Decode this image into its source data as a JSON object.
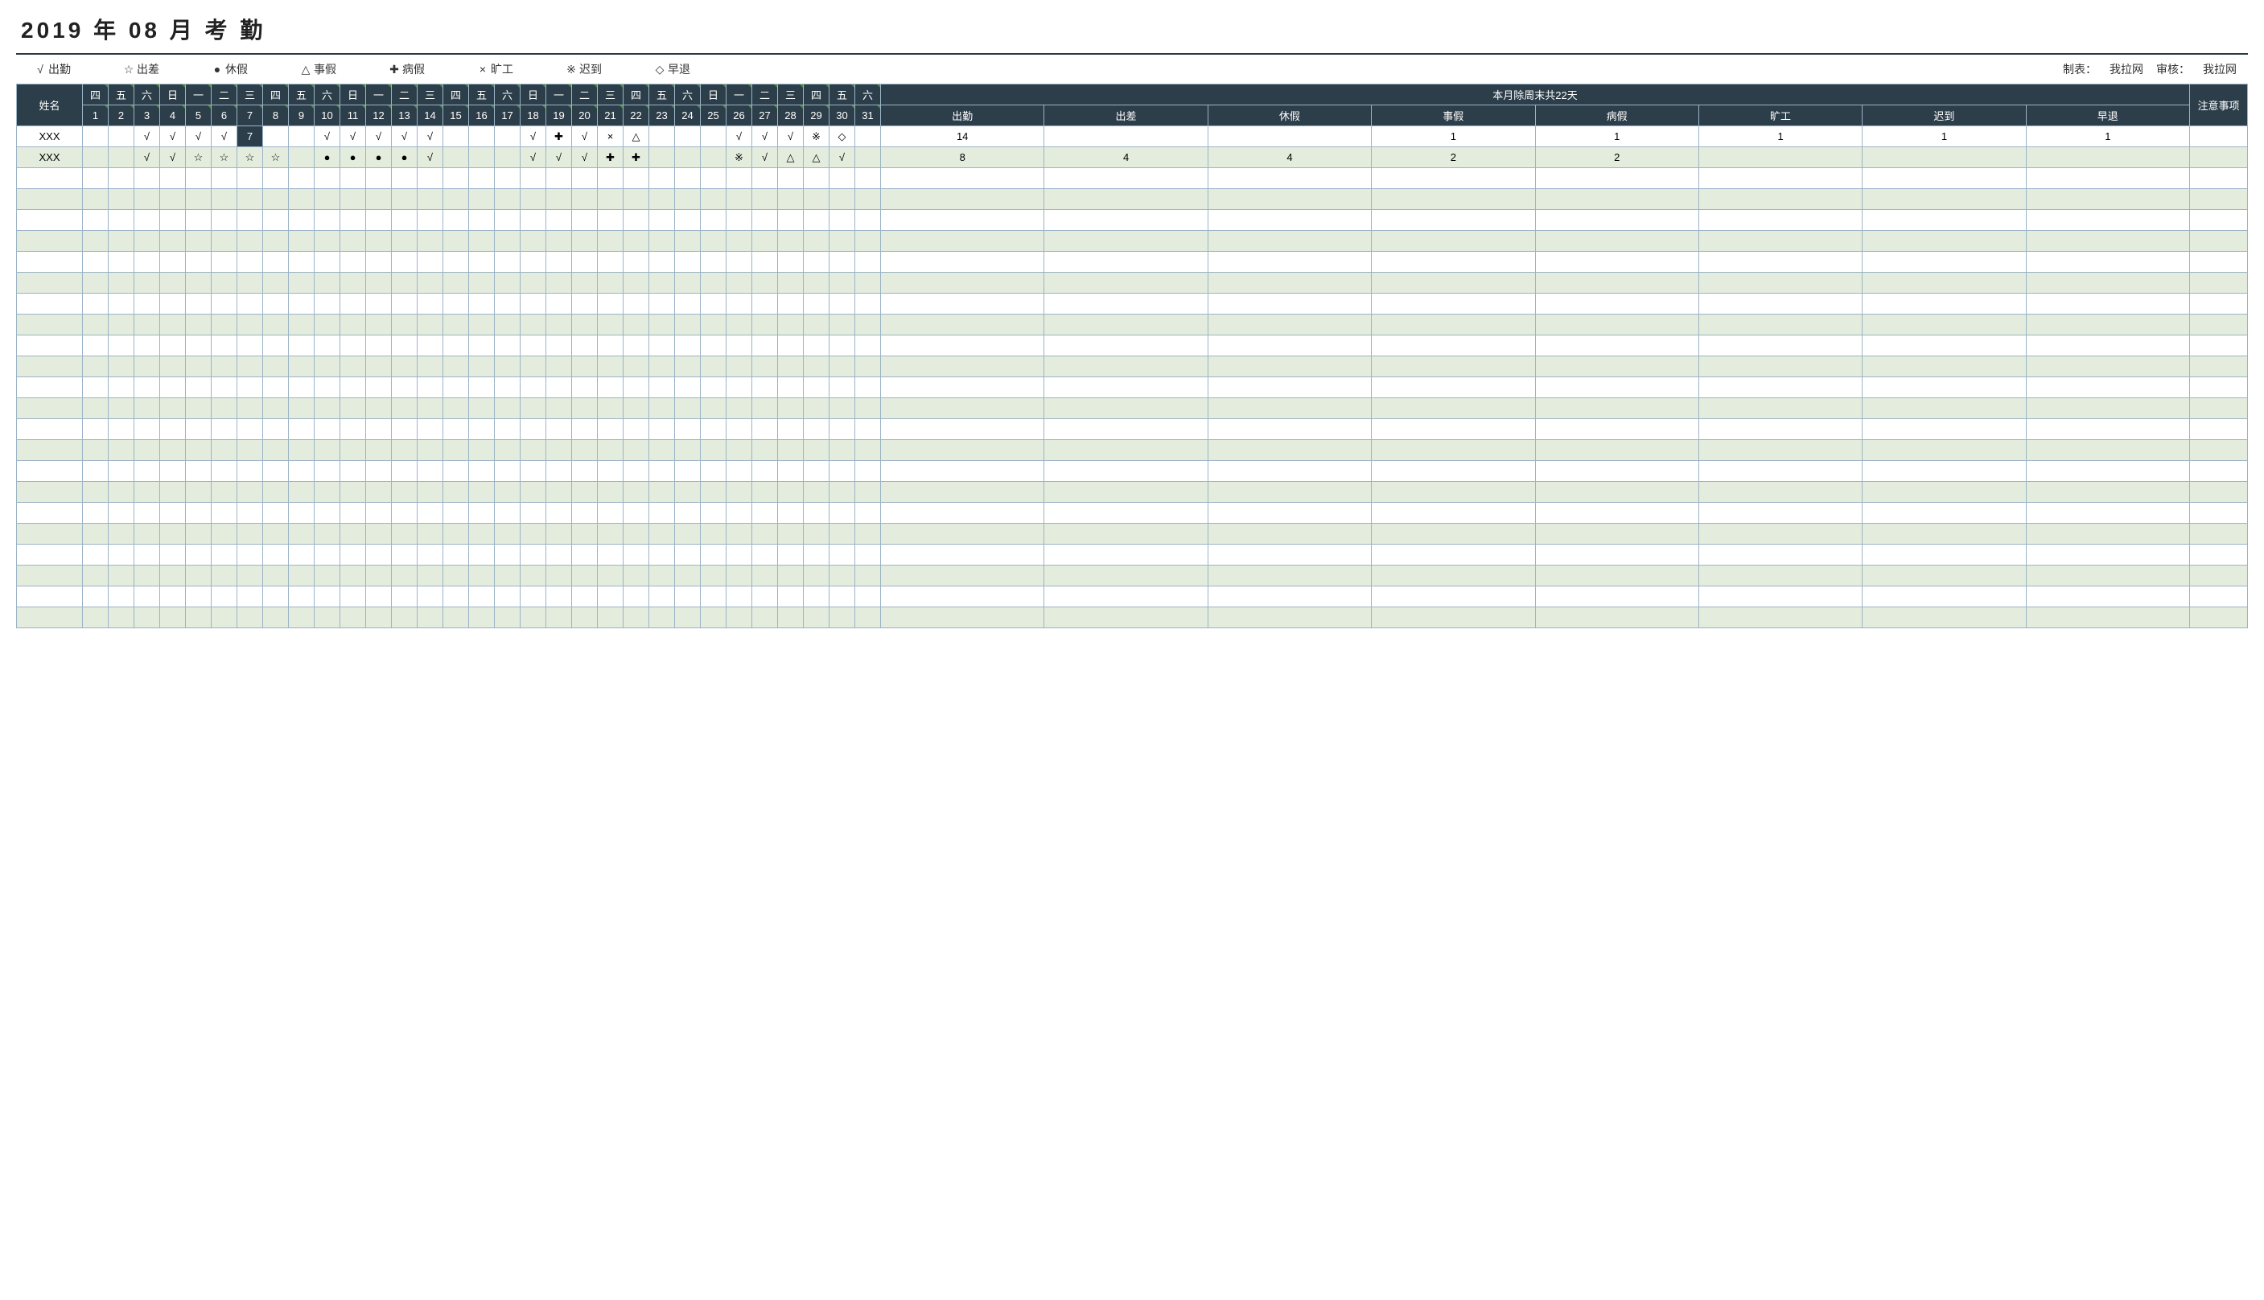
{
  "title": "2019   年   08    月   考 勤",
  "legend": [
    {
      "sym": "√",
      "label": "出勤"
    },
    {
      "sym": "☆",
      "label": "出差"
    },
    {
      "sym": "●",
      "label": "休假"
    },
    {
      "sym": "△",
      "label": "事假"
    },
    {
      "sym": "✚",
      "label": "病假"
    },
    {
      "sym": "×",
      "label": "旷工"
    },
    {
      "sym": "※",
      "label": "迟到"
    },
    {
      "sym": "◇",
      "label": "早退"
    }
  ],
  "meta": {
    "maker_label": "制表：",
    "maker_value": "我拉网",
    "reviewer_label": "审核：",
    "reviewer_value": "我拉网"
  },
  "header": {
    "name": "姓名",
    "weekdays": [
      "四",
      "五",
      "六",
      "日",
      "一",
      "二",
      "三",
      "四",
      "五",
      "六",
      "日",
      "一",
      "二",
      "三",
      "四",
      "五",
      "六",
      "日",
      "一",
      "二",
      "三",
      "四",
      "五",
      "六",
      "日",
      "一",
      "二",
      "三",
      "四",
      "五",
      "六"
    ],
    "days": [
      "1",
      "2",
      "3",
      "4",
      "5",
      "6",
      "7",
      "8",
      "9",
      "10",
      "11",
      "12",
      "13",
      "14",
      "15",
      "16",
      "17",
      "18",
      "19",
      "20",
      "21",
      "22",
      "23",
      "24",
      "25",
      "26",
      "27",
      "28",
      "29",
      "30",
      "31"
    ],
    "summary_title": "本月除周末共22天",
    "summary_cols": [
      "出勤",
      "出差",
      "休假",
      "事假",
      "病假",
      "旷工",
      "迟到",
      "早退"
    ],
    "notes": "注意事项"
  },
  "rows": [
    {
      "name": "XXX",
      "days": [
        "",
        "",
        "√",
        "√",
        "√",
        "√",
        "7",
        "",
        "",
        "√",
        "√",
        "√",
        "√",
        "√",
        "",
        "",
        "",
        "√",
        "✚",
        "√",
        "×",
        "△",
        "",
        "",
        "",
        "√",
        "√",
        "√",
        "※",
        "◇",
        ""
      ],
      "highlight_day_index": 6,
      "sums": [
        "14",
        "",
        "",
        "1",
        "1",
        "1",
        "1",
        "1"
      ],
      "notes": ""
    },
    {
      "name": "XXX",
      "days": [
        "",
        "",
        "√",
        "√",
        "☆",
        "☆",
        "☆",
        "☆",
        "",
        "●",
        "●",
        "●",
        "●",
        "√",
        "",
        "",
        "",
        "√",
        "√",
        "√",
        "✚",
        "✚",
        "",
        "",
        "",
        "※",
        "√",
        "△",
        "△",
        "√",
        ""
      ],
      "sums": [
        "8",
        "4",
        "4",
        "2",
        "2",
        "",
        "",
        ""
      ],
      "notes": ""
    }
  ],
  "empty_rows": 22
}
